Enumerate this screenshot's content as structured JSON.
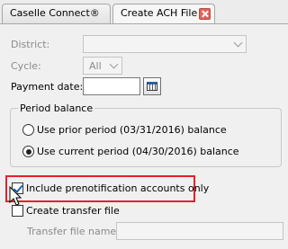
{
  "tabs": [
    {
      "label": "Caselle Connect®"
    },
    {
      "label": "Create ACH File"
    }
  ],
  "form": {
    "district_label": "District:",
    "district_value": "",
    "cycle_label": "Cycle:",
    "cycle_value": "All",
    "payment_date_label": "Payment date:",
    "payment_date_value": ""
  },
  "period_balance": {
    "title": "Period balance",
    "options": [
      {
        "label": "Use prior period (03/31/2016) balance",
        "selected": false
      },
      {
        "label": "Use current period (04/30/2016) balance",
        "selected": true
      }
    ]
  },
  "options": {
    "include_prenotification_label": "Include prenotification accounts only",
    "include_prenotification_checked": true,
    "create_transfer_label": "Create transfer file",
    "create_transfer_checked": false,
    "transfer_file_name_label": "Transfer file name:",
    "transfer_file_name_value": ""
  },
  "colors": {
    "highlight": "#e8202a",
    "tab_close": "#e2645c"
  }
}
